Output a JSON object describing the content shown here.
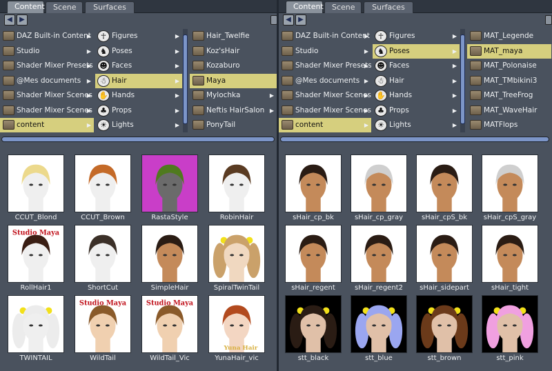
{
  "left": {
    "tabs": [
      "Content",
      "Scene",
      "Surfaces"
    ],
    "active_tab": 0,
    "col1": [
      {
        "label": "DAZ Built-in Content",
        "arrow": true
      },
      {
        "label": "Studio",
        "arrow": true
      },
      {
        "label": "Shader Mixer Presets",
        "arrow": true
      },
      {
        "label": "@Mes documents",
        "arrow": true
      },
      {
        "label": "Shader Mixer Scenes",
        "arrow": true
      },
      {
        "label": "Shader Mixer Scenes",
        "arrow": true
      },
      {
        "label": "content",
        "arrow": true,
        "selected": true
      }
    ],
    "col2": [
      {
        "label": "Figures",
        "icon": "figure-icon",
        "arrow": true
      },
      {
        "label": "Poses",
        "icon": "pose-icon",
        "arrow": true
      },
      {
        "label": "Faces",
        "icon": "face-icon",
        "arrow": true
      },
      {
        "label": "Hair",
        "icon": "hair-icon",
        "arrow": true,
        "selected": true
      },
      {
        "label": "Hands",
        "icon": "hand-icon",
        "arrow": true
      },
      {
        "label": "Props",
        "icon": "props-icon",
        "arrow": true
      },
      {
        "label": "Lights",
        "icon": "light-icon",
        "arrow": true
      }
    ],
    "col3": [
      {
        "label": "Hair_Twelfie",
        "arrow": false
      },
      {
        "label": "Koz'sHair",
        "arrow": false
      },
      {
        "label": "Kozaburo",
        "arrow": false
      },
      {
        "label": "Maya",
        "arrow": false,
        "selected": true
      },
      {
        "label": "Mylochka",
        "arrow": true
      },
      {
        "label": "Neftis HairSalon",
        "arrow": true
      },
      {
        "label": "PonyTail",
        "arrow": false
      }
    ],
    "thumbnails": [
      {
        "label": "CCUT_Blond",
        "bg": "#ffffff",
        "hair": "#ecd98c",
        "skin": "#efefef"
      },
      {
        "label": "CCUT_Brown",
        "bg": "#ffffff",
        "hair": "#c46a28",
        "skin": "#efefef"
      },
      {
        "label": "RastaStyle",
        "bg": "#c93ec8",
        "hair": "#4f7a1e",
        "skin": "#6b6b6b"
      },
      {
        "label": "RobinHair",
        "bg": "#ffffff",
        "hair": "#5a3b22",
        "skin": "#efefef"
      },
      {
        "label": "RollHair1",
        "bg": "#ffffff",
        "hair": "#3a1e14",
        "skin": "#efefef"
      },
      {
        "label": "ShortCut",
        "bg": "#ffffff",
        "hair": "#3b3028",
        "skin": "#efefef"
      },
      {
        "label": "SimpleHair",
        "bg": "#ffffff",
        "hair": "#2a1c14",
        "skin": "#c48a5a"
      },
      {
        "label": "SpiralTwinTail",
        "bg": "#ffffff",
        "hair": "#caa16a",
        "skin": "#f0d8c0"
      },
      {
        "label": "TWINTAIL",
        "bg": "#ffffff",
        "hair": "#ececec",
        "skin": "#efefef"
      },
      {
        "label": "WildTail",
        "bg": "#ffffff",
        "hair": "#8a5a2a",
        "skin": "#f0d0b0"
      },
      {
        "label": "WildTail_Vic",
        "bg": "#ffffff",
        "hair": "#8a5a2a",
        "skin": "#f0d0b0"
      },
      {
        "label": "YunaHair_vic",
        "bg": "#ffffff",
        "hair": "#b24a1e",
        "skin": "#f3d6c2"
      }
    ],
    "watermark": "Studio Maya",
    "watermark2": "Yuna Hair"
  },
  "right": {
    "tabs": [
      "Content",
      "Scene",
      "Surfaces"
    ],
    "active_tab": 0,
    "col1": [
      {
        "label": "DAZ Built-in Content",
        "arrow": true
      },
      {
        "label": "Studio",
        "arrow": true
      },
      {
        "label": "Shader Mixer Presets",
        "arrow": true
      },
      {
        "label": "@Mes documents",
        "arrow": true
      },
      {
        "label": "Shader Mixer Scenes",
        "arrow": true
      },
      {
        "label": "Shader Mixer Scenes",
        "arrow": true
      },
      {
        "label": "content",
        "arrow": true,
        "selected": true
      }
    ],
    "col2": [
      {
        "label": "Figures",
        "icon": "figure-icon",
        "arrow": true
      },
      {
        "label": "Poses",
        "icon": "pose-icon",
        "arrow": true,
        "selected": true
      },
      {
        "label": "Faces",
        "icon": "face-icon",
        "arrow": true
      },
      {
        "label": "Hair",
        "icon": "hair-icon",
        "arrow": true
      },
      {
        "label": "Hands",
        "icon": "hand-icon",
        "arrow": true
      },
      {
        "label": "Props",
        "icon": "props-icon",
        "arrow": true
      },
      {
        "label": "Lights",
        "icon": "light-icon",
        "arrow": true
      }
    ],
    "col3": [
      {
        "label": "MAT_Legende",
        "arrow": false
      },
      {
        "label": "MAT_maya",
        "arrow": false,
        "selected": true
      },
      {
        "label": "MAT_Polonaise",
        "arrow": false
      },
      {
        "label": "MAT_TMbikini3",
        "arrow": false
      },
      {
        "label": "MAT_TreeFrog",
        "arrow": false
      },
      {
        "label": "MAT_WaveHair",
        "arrow": false
      },
      {
        "label": "MATFlops",
        "arrow": false
      }
    ],
    "thumbnails": [
      {
        "label": "sHair_cp_bk",
        "bg": "#ffffff",
        "hair": "#2a1c14",
        "skin": "#c48a5a"
      },
      {
        "label": "sHair_cp_gray",
        "bg": "#ffffff",
        "hair": "#cfcfcf",
        "skin": "#c48a5a"
      },
      {
        "label": "sHair_cpS_bk",
        "bg": "#ffffff",
        "hair": "#2a1c14",
        "skin": "#c48a5a"
      },
      {
        "label": "sHair_cpS_gray",
        "bg": "#ffffff",
        "hair": "#cfcfcf",
        "skin": "#c48a5a"
      },
      {
        "label": "sHair_regent",
        "bg": "#ffffff",
        "hair": "#2a1c14",
        "skin": "#c48a5a"
      },
      {
        "label": "sHair_regent2",
        "bg": "#ffffff",
        "hair": "#2a1c14",
        "skin": "#c48a5a"
      },
      {
        "label": "sHair_sidepart",
        "bg": "#ffffff",
        "hair": "#2a1c14",
        "skin": "#c48a5a"
      },
      {
        "label": "sHair_tight",
        "bg": "#ffffff",
        "hair": "#2a1c14",
        "skin": "#c48a5a"
      },
      {
        "label": "stt_black",
        "bg": "#000000",
        "hair": "#2a1c14",
        "skin": "#e0c0a8"
      },
      {
        "label": "stt_blue",
        "bg": "#000000",
        "hair": "#9aa6f0",
        "skin": "#e0c0a8"
      },
      {
        "label": "stt_brown",
        "bg": "#000000",
        "hair": "#6b3a1a",
        "skin": "#e0c0a8"
      },
      {
        "label": "stt_pink",
        "bg": "#000000",
        "hair": "#f0a0e0",
        "skin": "#e0c0a8"
      }
    ]
  }
}
